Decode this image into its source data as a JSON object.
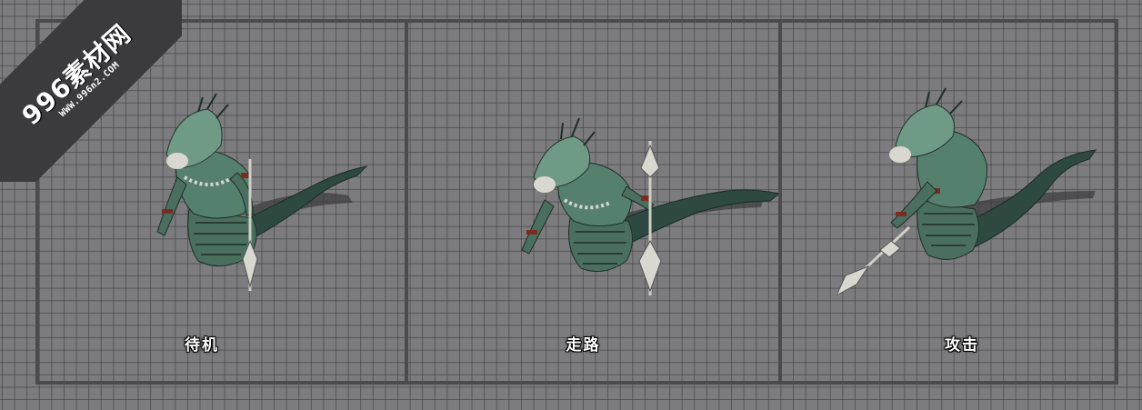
{
  "watermark": {
    "title": "996素材网",
    "url": "WWW.996n2.COM"
  },
  "frames": [
    {
      "label": "待机"
    },
    {
      "label": "走路"
    },
    {
      "label": "攻击"
    }
  ],
  "colors": {
    "background": "#7c7b7d",
    "grid_line": "#37373a",
    "panel_border": "#4b4a4d",
    "creature_body": "#4f7566",
    "creature_dark": "#24372f",
    "bone": "#d8d8d0"
  }
}
